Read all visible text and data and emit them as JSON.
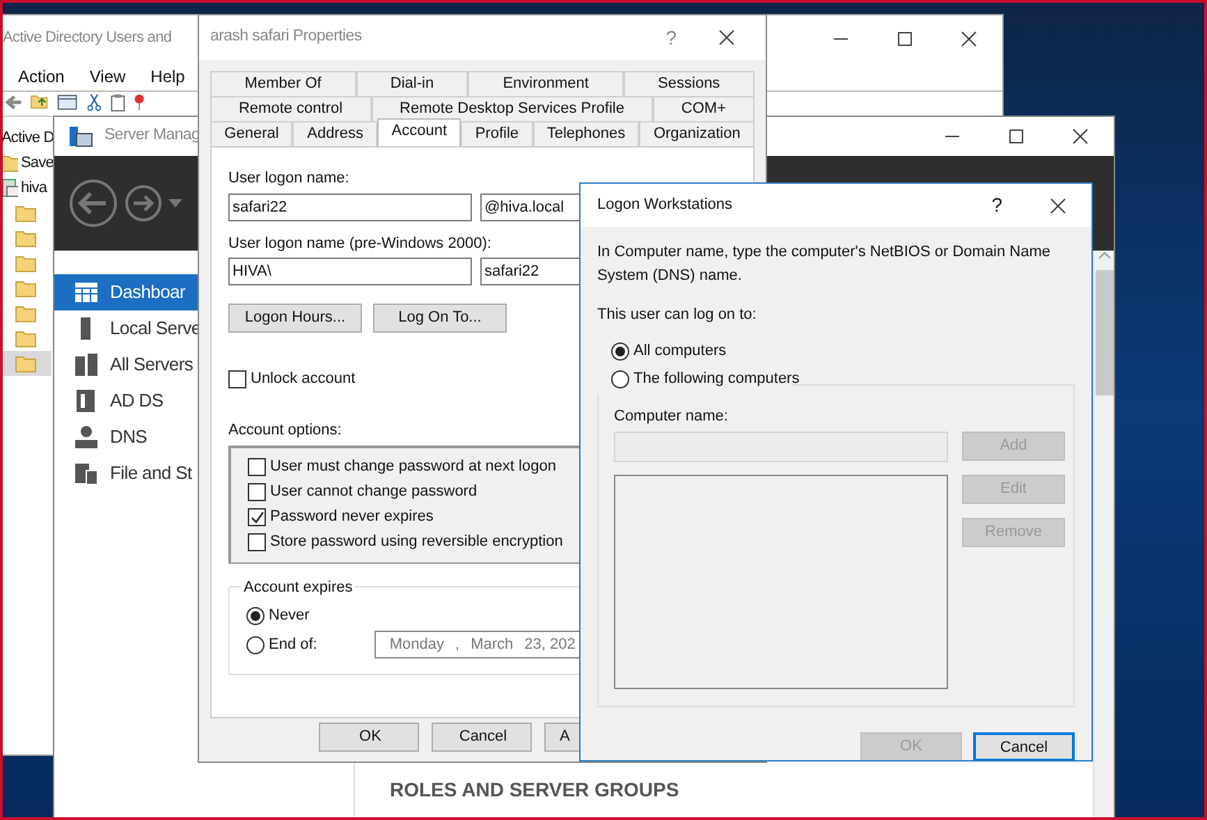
{
  "ad_window": {
    "title": "Active Directory Users and",
    "menu": [
      "Action",
      "View",
      "Help"
    ],
    "tree": [
      {
        "label": "Active D",
        "children": [
          {
            "label": "Save"
          },
          {
            "label": "hiva",
            "children": [
              {
                "selected": false
              },
              {
                "selected": false
              },
              {
                "selected": false
              },
              {
                "selected": false
              },
              {
                "selected": false
              },
              {
                "selected": false
              },
              {
                "selected": true
              }
            ]
          }
        ]
      }
    ]
  },
  "server_manager": {
    "title": "Server Manag",
    "nav": [
      {
        "label": "Dashboar",
        "selected": true,
        "kind": "dashboard"
      },
      {
        "label": "Local Serve",
        "selected": false,
        "kind": "server"
      },
      {
        "label": "All Servers",
        "selected": false,
        "kind": "servers"
      },
      {
        "label": "AD DS",
        "selected": false,
        "kind": "adds"
      },
      {
        "label": "DNS",
        "selected": false,
        "kind": "dns"
      },
      {
        "label": "File and St",
        "selected": false,
        "kind": "files"
      }
    ],
    "section_title": "ROLES AND SERVER GROUPS"
  },
  "properties": {
    "title": "arash safari Properties",
    "help": "?",
    "tab_rows": [
      [
        {
          "label": "Member Of",
          "selected": false
        },
        {
          "label": "Dial-in",
          "selected": false
        },
        {
          "label": "Environment",
          "selected": false
        },
        {
          "label": "Sessions",
          "selected": false
        }
      ],
      [
        {
          "label": "Remote control",
          "selected": false
        },
        {
          "label": "Remote Desktop Services Profile",
          "selected": false
        },
        {
          "label": "COM+",
          "selected": false
        }
      ],
      [
        {
          "label": "General",
          "selected": false
        },
        {
          "label": "Address",
          "selected": false
        },
        {
          "label": "Account",
          "selected": true
        },
        {
          "label": "Profile",
          "selected": false
        },
        {
          "label": "Telephones",
          "selected": false
        },
        {
          "label": "Organization",
          "selected": false
        }
      ]
    ],
    "logon_label": "User logon name:",
    "logon_value": "safari22",
    "domain_value": "@hiva.local",
    "pre2000_label": "User logon name (pre-Windows 2000):",
    "pre2000_domain": "HIVA\\",
    "pre2000_value": "safari22",
    "action_buttons": [
      "Logon Hours...",
      "Log On To..."
    ],
    "unlock": {
      "label": "Unlock account",
      "checked": false
    },
    "options_label": "Account options:",
    "account_options": [
      {
        "label": "User must change password at next logon",
        "checked": false
      },
      {
        "label": "User cannot change password",
        "checked": false
      },
      {
        "label": "Password never expires",
        "checked": true
      },
      {
        "label": "Store password using reversible encryption",
        "checked": false
      }
    ],
    "expires_label": "Account expires",
    "expires": [
      {
        "label": "Never",
        "selected": true
      },
      {
        "label": "End of:",
        "selected": false
      }
    ],
    "date_parts": [
      "Monday",
      ",",
      "March",
      "23, 202"
    ],
    "buttons": [
      "OK",
      "Cancel",
      "A"
    ]
  },
  "logon_workstations": {
    "title": "Logon Workstations",
    "help": "?",
    "description": "In Computer name, type the computer's NetBIOS or Domain Name System (DNS) name.",
    "prompt": "This user can log on to:",
    "choices": [
      {
        "label": "All computers",
        "selected": true
      },
      {
        "label": "The following computers",
        "selected": false
      }
    ],
    "computer_name_label": "Computer name:",
    "side_buttons": [
      {
        "label": "Add",
        "disabled": true
      },
      {
        "label": "Edit",
        "disabled": true
      },
      {
        "label": "Remove",
        "disabled": true
      }
    ],
    "buttons": [
      {
        "label": "OK",
        "disabled": true
      },
      {
        "label": "Cancel",
        "disabled": false
      }
    ]
  }
}
